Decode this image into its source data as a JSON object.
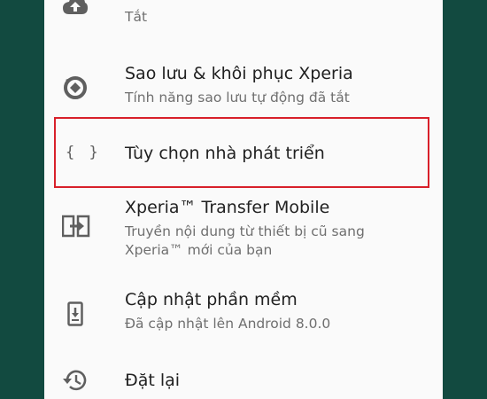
{
  "settings_list": {
    "items": [
      {
        "title": "",
        "subtitle": "Tắt",
        "icon": "cloud-upload-icon"
      },
      {
        "title": "Sao lưu & khôi phục Xperia",
        "subtitle": "Tính năng sao lưu tự động đã tắt",
        "icon": "backup-restore-icon"
      },
      {
        "title": "Tùy chọn nhà phát triển",
        "subtitle": "",
        "icon": "code-braces-icon",
        "glyph": "{ }",
        "highlighted": true
      },
      {
        "title": "Xperia™ Transfer Mobile",
        "subtitle": "Truyền nội dung từ thiết bị cũ sang Xperia™ mới của bạn",
        "icon": "transfer-icon"
      },
      {
        "title": "Cập nhật phần mềm",
        "subtitle": "Đã cập nhật lên Android 8.0.0",
        "icon": "system-update-icon"
      },
      {
        "title": "Đặt lại",
        "subtitle": "",
        "icon": "history-reset-icon"
      }
    ]
  },
  "colors": {
    "background": "#124a40",
    "panel": "#fafafa",
    "highlight_border": "#d8202a",
    "icon": "#5f5f5f"
  }
}
